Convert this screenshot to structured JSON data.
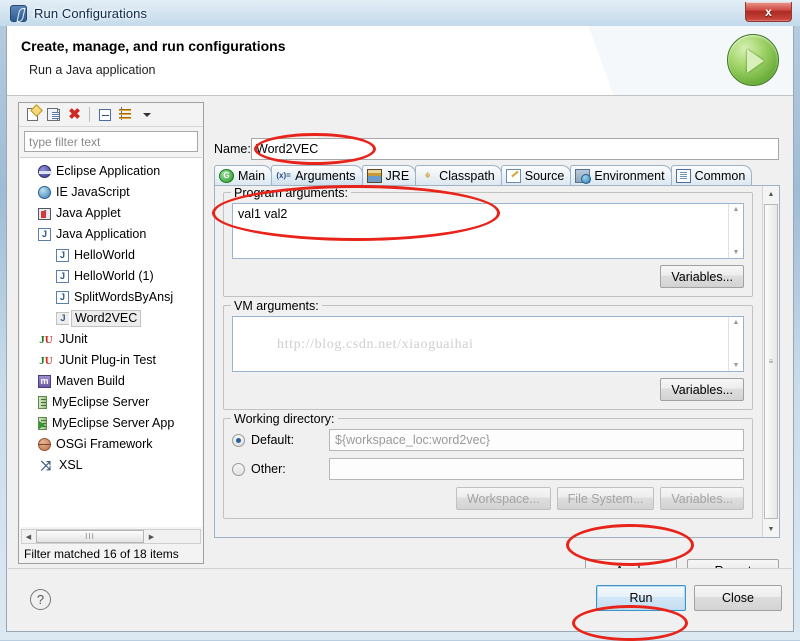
{
  "window": {
    "title": "Run Configurations",
    "title_icon": "run-config-icon",
    "close_label": "x"
  },
  "header": {
    "title": "Create, manage, and run configurations",
    "subtitle": "Run a Java application",
    "run_glyph": "run-play-icon"
  },
  "tree_toolbar": {
    "buttons": [
      {
        "name": "new-configuration",
        "icon": "new-document-icon"
      },
      {
        "name": "duplicate-configuration",
        "icon": "duplicate-icon"
      },
      {
        "name": "delete-configuration",
        "icon": "delete-x-icon",
        "glyph": "✖"
      },
      {
        "name": "collapse-all",
        "icon": "collapse-all-icon"
      },
      {
        "name": "filter-configurations",
        "icon": "filter-icon"
      },
      {
        "name": "toolbar-menu",
        "icon": "chevron-down-icon"
      }
    ]
  },
  "filter": {
    "placeholder": "type filter text",
    "value": "",
    "status": "Filter matched 16 of 18 items",
    "hscroll_grip": "III"
  },
  "tree": {
    "items": [
      {
        "label": "Eclipse Application",
        "icon": "eclipse-icon",
        "level": 0,
        "selected": false
      },
      {
        "label": "IE JavaScript",
        "icon": "ie-javascript-icon",
        "level": 0,
        "selected": false
      },
      {
        "label": "Java Applet",
        "icon": "java-applet-icon",
        "level": 0,
        "selected": false
      },
      {
        "label": "Java Application",
        "icon": "java-application-icon",
        "level": 0,
        "selected": false
      },
      {
        "label": "HelloWorld",
        "icon": "java-application-icon",
        "level": 1,
        "selected": false
      },
      {
        "label": "HelloWorld (1)",
        "icon": "java-application-icon",
        "level": 1,
        "selected": false
      },
      {
        "label": "SplitWordsByAnsj",
        "icon": "java-application-icon",
        "level": 1,
        "selected": false
      },
      {
        "label": "Word2VEC",
        "icon": "java-application-icon",
        "level": 1,
        "selected": true
      },
      {
        "label": "JUnit",
        "icon": "junit-icon",
        "level": 0,
        "selected": false
      },
      {
        "label": "JUnit Plug-in Test",
        "icon": "junit-plugin-icon",
        "level": 0,
        "selected": false
      },
      {
        "label": "Maven Build",
        "icon": "maven-icon",
        "level": 0,
        "selected": false
      },
      {
        "label": "MyEclipse Server",
        "icon": "server-icon",
        "level": 0,
        "selected": false
      },
      {
        "label": "MyEclipse Server App",
        "icon": "server-app-icon",
        "level": 0,
        "selected": false
      },
      {
        "label": "OSGi Framework",
        "icon": "osgi-icon",
        "level": 0,
        "selected": false
      },
      {
        "label": "XSL",
        "icon": "xsl-icon",
        "level": 0,
        "selected": false
      }
    ]
  },
  "name_field": {
    "label": "Name:",
    "value": "Word2VEC"
  },
  "tabs": [
    {
      "label": "Main",
      "icon": "main-tab-icon",
      "glyph": "G",
      "active": false
    },
    {
      "label": "Arguments",
      "icon": "arguments-tab-icon",
      "glyph": "(x)=",
      "active": true
    },
    {
      "label": "JRE",
      "icon": "jre-tab-icon",
      "active": false
    },
    {
      "label": "Classpath",
      "icon": "classpath-tab-icon",
      "glyph": "☬",
      "active": false
    },
    {
      "label": "Source",
      "icon": "source-tab-icon",
      "active": false
    },
    {
      "label": "Environment",
      "icon": "environment-tab-icon",
      "active": false
    },
    {
      "label": "Common",
      "icon": "common-tab-icon",
      "active": false
    }
  ],
  "program_arguments": {
    "title": "Program arguments:",
    "value": "val1 val2",
    "variables_label": "Variables..."
  },
  "vm_arguments": {
    "title": "VM arguments:",
    "value": "",
    "watermark": "http://blog.csdn.net/xiaoguaihai",
    "variables_label": "Variables..."
  },
  "working_directory": {
    "title": "Working directory:",
    "default_label": "Default:",
    "default_value": "${workspace_loc:word2vec}",
    "default_selected": true,
    "other_label": "Other:",
    "other_value": "",
    "other_selected": false,
    "workspace_label": "Workspace...",
    "file_system_label": "File System...",
    "variables_label": "Variables..."
  },
  "actions": {
    "apply_label": "Apply",
    "revert_label": "Revert",
    "run_label": "Run",
    "close_label": "Close",
    "help_label": "?"
  },
  "scrollbars": {
    "up_arrow": "▲",
    "down_arrow": "▼",
    "left_arrow": "◀",
    "right_arrow": "▶",
    "thumb_grip": "≡"
  },
  "annotations": {
    "accent_color": "#e8231a",
    "marks": [
      "arguments-tab",
      "program-arguments-field",
      "apply-button",
      "run-button"
    ]
  }
}
